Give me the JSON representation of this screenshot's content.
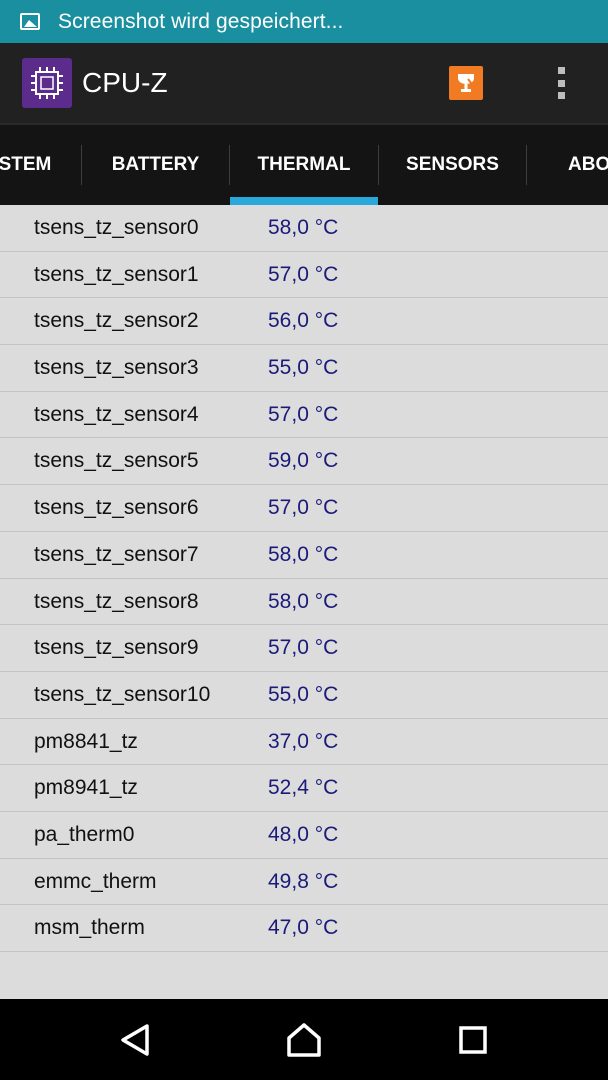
{
  "status_bar": {
    "notification_text": "Screenshot wird gespeichert...",
    "icon": "image-icon"
  },
  "app_bar": {
    "title": "CPU-Z",
    "logo_icon": "cpu-chip-icon",
    "actions": [
      {
        "name": "validate",
        "icon": "validation-cup-icon",
        "color": "#f07b22"
      },
      {
        "name": "more",
        "icon": "overflow-menu-icon"
      }
    ]
  },
  "tabs": [
    {
      "label": "STEM",
      "selected": false
    },
    {
      "label": "BATTERY",
      "selected": false
    },
    {
      "label": "THERMAL",
      "selected": true
    },
    {
      "label": "SENSORS",
      "selected": false
    },
    {
      "label": "ABO",
      "selected": false
    }
  ],
  "accent_color": "#29a8dc",
  "thermal_rows": [
    {
      "name": "tsens_tz_sensor0",
      "value": "58,0 °C"
    },
    {
      "name": "tsens_tz_sensor1",
      "value": "57,0 °C"
    },
    {
      "name": "tsens_tz_sensor2",
      "value": "56,0 °C"
    },
    {
      "name": "tsens_tz_sensor3",
      "value": "55,0 °C"
    },
    {
      "name": "tsens_tz_sensor4",
      "value": "57,0 °C"
    },
    {
      "name": "tsens_tz_sensor5",
      "value": "59,0 °C"
    },
    {
      "name": "tsens_tz_sensor6",
      "value": "57,0 °C"
    },
    {
      "name": "tsens_tz_sensor7",
      "value": "58,0 °C"
    },
    {
      "name": "tsens_tz_sensor8",
      "value": "58,0 °C"
    },
    {
      "name": "tsens_tz_sensor9",
      "value": "57,0 °C"
    },
    {
      "name": "tsens_tz_sensor10",
      "value": "55,0 °C"
    },
    {
      "name": "pm8841_tz",
      "value": "37,0 °C"
    },
    {
      "name": "pm8941_tz",
      "value": "52,4 °C"
    },
    {
      "name": "pa_therm0",
      "value": "48,0 °C"
    },
    {
      "name": "emmc_therm",
      "value": "49,8 °C"
    },
    {
      "name": "msm_therm",
      "value": "47,0 °C"
    }
  ],
  "nav_bar": {
    "buttons": [
      {
        "name": "back",
        "icon": "back-triangle-icon"
      },
      {
        "name": "home",
        "icon": "home-icon"
      },
      {
        "name": "recents",
        "icon": "recents-square-icon"
      }
    ]
  }
}
